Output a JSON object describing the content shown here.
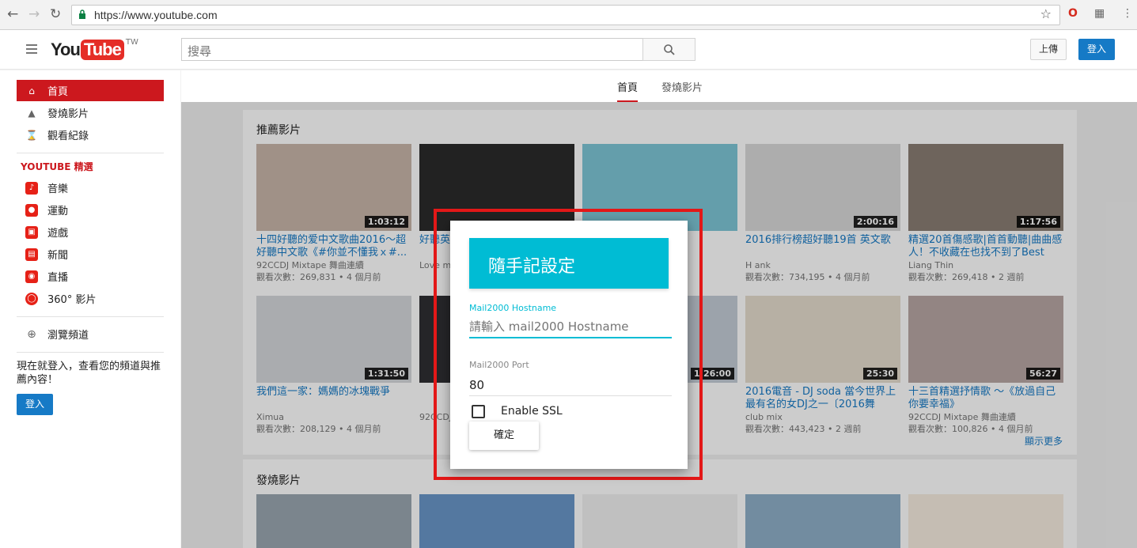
{
  "browser": {
    "url": "https://www.youtube.com"
  },
  "header": {
    "logo_you": "You",
    "logo_tube": "Tube",
    "region": "TW",
    "search_placeholder": "搜尋",
    "upload": "上傳",
    "signin": "登入"
  },
  "sidebar": {
    "main_items": [
      {
        "label": "首頁"
      },
      {
        "label": "發燒影片"
      },
      {
        "label": "觀看紀錄"
      }
    ],
    "section_title": "YOUTUBE 精選",
    "featured_items": [
      {
        "label": "音樂"
      },
      {
        "label": "運動"
      },
      {
        "label": "遊戲"
      },
      {
        "label": "新聞"
      },
      {
        "label": "直播"
      },
      {
        "label": "360° 影片"
      }
    ],
    "browse": "瀏覽頻道",
    "prompt": "現在就登入，查看您的頻道與推薦內容！",
    "signin": "登入"
  },
  "tabs": [
    {
      "label": "首頁"
    },
    {
      "label": "發燒影片"
    }
  ],
  "recommended": {
    "title": "推薦影片",
    "more": "顯示更多",
    "videos": [
      {
        "title": "十四好聽的爱中文歌曲2016～超好聽中文歌《#你並不懂我ｘ#...",
        "channel": "92CCDJ Mixtape 舞曲連續",
        "meta": "觀看次數：269,831 • 4 個月前",
        "duration": "1:03:12",
        "color": "#c9b6a9"
      },
      {
        "title": "好聽英文",
        "channel": "Love music",
        "meta": "",
        "duration": "",
        "color": "#2b2b2b"
      },
      {
        "title": "",
        "channel": "",
        "meta": "",
        "duration": "",
        "color": "#7ec6d6"
      },
      {
        "title": "2016排行榜超好聽19首 英文歌",
        "channel": "H ank",
        "meta": "觀看次數：734,195 • 4 個月前",
        "duration": "2:00:16",
        "color": "#d9d9d9"
      },
      {
        "title": "精選20首傷感歌|首首動聽|曲曲感人！不收藏在也找不到了Best S...",
        "channel": "Liang Thin",
        "meta": "觀看次數：269,418 • 2 週前",
        "duration": "1:17:56",
        "color": "#8a7d74"
      },
      {
        "title": "我們這一家：媽媽的冰塊戰爭",
        "channel": "Ximua",
        "meta": "觀看次數：208,129 • 4 個月前",
        "duration": "1:31:50",
        "color": "#d5d8db"
      },
      {
        "title": "",
        "channel": "92CCDJ",
        "meta": "",
        "duration": "",
        "color": "#2f2f33"
      },
      {
        "title": "",
        "channel": "",
        "meta": "",
        "duration": "1:26:00",
        "color": "#c4ccd6"
      },
      {
        "title": "2016電音 - DJ soda 當今世界上最有名的女DJ之一〔2016舞曲〕...",
        "channel": "club mix",
        "meta": "觀看次數：443,423 • 2 週前",
        "duration": "25:30",
        "color": "#e5dccd"
      },
      {
        "title": "十三首精選抒情歌 ～《放過自己你要幸福》",
        "channel": "92CCDJ Mixtape 舞曲連續",
        "meta": "觀看次數：100,826 • 4 個月前",
        "duration": "56:27",
        "color": "#b8a7a4"
      }
    ]
  },
  "trending": {
    "title": "發燒影片",
    "videos": [
      {
        "color": "#9aa7b1"
      },
      {
        "color": "#6a96c9"
      },
      {
        "color": "#f0f0f0"
      },
      {
        "color": "#8fb0c9"
      },
      {
        "color": "#f7ede0"
      }
    ]
  },
  "dialog": {
    "title": "隨手記設定",
    "host_label": "Mail2000 Hostname",
    "host_placeholder": "請輸入 mail2000 Hostname",
    "port_label": "Mail2000 Port",
    "port_value": "80",
    "ssl_label": "Enable SSL",
    "ok": "確定",
    "accent": "#00bcd4"
  }
}
